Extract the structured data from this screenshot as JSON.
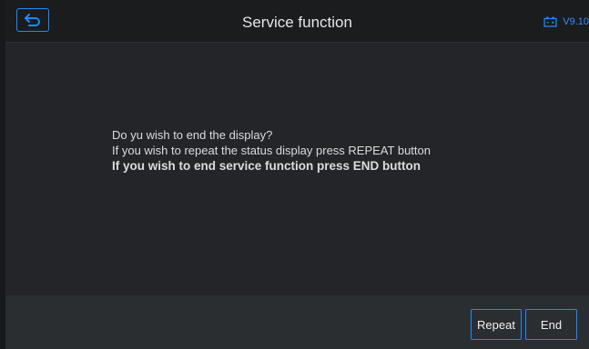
{
  "header": {
    "title": "Service function",
    "back_icon": "back-arrow-icon",
    "battery_icon": "battery-icon",
    "version": "V9.10"
  },
  "message": {
    "line1": "Do yu wish to end the display?",
    "line2": "If you wish to repeat the status display press REPEAT button",
    "line3": "If you wish to end service function press END button"
  },
  "footer": {
    "repeat_label": "Repeat",
    "end_label": "End"
  },
  "colors": {
    "accent": "#1e88ff",
    "background": "#232528",
    "header_bg": "#1a1c1e",
    "footer_bg": "#2b2e31",
    "text": "#dcdcdc"
  }
}
